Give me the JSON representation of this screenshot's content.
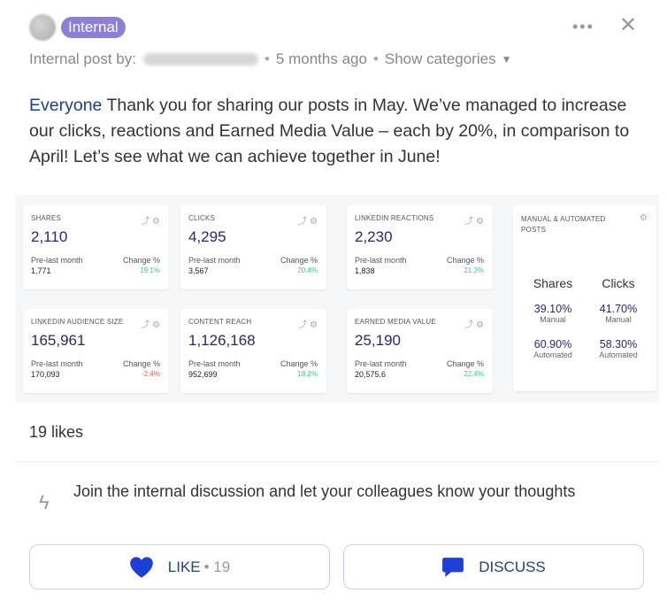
{
  "header": {
    "badge": "Internal",
    "more_icon": "ellipsis-icon",
    "close_icon": "close-icon"
  },
  "meta": {
    "prefix": "Internal post by:",
    "time": "5 months ago",
    "categories": "Show categories"
  },
  "post": {
    "mention": "Everyone",
    "text": " Thank you for sharing our posts in May. We’ve managed to increase our clicks, reactions and Earned Media Value – each by 20%, in comparison to April! Let’s see what we can achieve together in June!"
  },
  "dashboard": {
    "tiles": [
      {
        "title": "SHARES",
        "value": "2,110",
        "pre_label": "Pre-last month",
        "pre_value": "1,771",
        "change_label": "Change %",
        "change": "19.1%",
        "trend": "up"
      },
      {
        "title": "CLICKS",
        "value": "4,295",
        "pre_label": "Pre-last month",
        "pre_value": "3,567",
        "change_label": "Change %",
        "change": "20.4%",
        "trend": "up"
      },
      {
        "title": "LINKEDIN REACTIONS",
        "value": "2,230",
        "pre_label": "Pre-last month",
        "pre_value": "1,838",
        "change_label": "Change %",
        "change": "21.3%",
        "trend": "up"
      },
      {
        "title": "LINKEDIN AUDIENCE SIZE",
        "value": "165,961",
        "pre_label": "Pre-last month",
        "pre_value": "170,093",
        "change_label": "Change %",
        "change": "-2.4%",
        "trend": "down"
      },
      {
        "title": "CONTENT REACH",
        "value": "1,126,168",
        "pre_label": "Pre-last month",
        "pre_value": "952,699",
        "change_label": "Change %",
        "change": "18.2%",
        "trend": "up"
      },
      {
        "title": "EARNED MEDIA VALUE",
        "value": "25,190",
        "pre_label": "Pre-last month",
        "pre_value": "20,575.6",
        "change_label": "Change %",
        "change": "22.4%",
        "trend": "up"
      }
    ],
    "manual_auto": {
      "title": "MANUAL & AUTOMATED POSTS",
      "col1": {
        "head": "Shares",
        "manual": "39.10%",
        "manual_label": "Manual",
        "auto": "60.90%",
        "auto_label": "Automated"
      },
      "col2": {
        "head": "Clicks",
        "manual": "41.70%",
        "manual_label": "Manual",
        "auto": "58.30%",
        "auto_label": "Automated"
      }
    }
  },
  "likes": "19 likes",
  "discussion_prompt": "Join the internal discussion and let your colleagues know your thoughts",
  "actions": {
    "like_label": "LIKE",
    "like_count": "• 19",
    "discuss_label": "DISCUSS"
  },
  "colors": {
    "badge": "#8e7fd6",
    "accent": "#1d3f8c",
    "positive": "#3cc68a",
    "negative": "#e05a5a"
  }
}
